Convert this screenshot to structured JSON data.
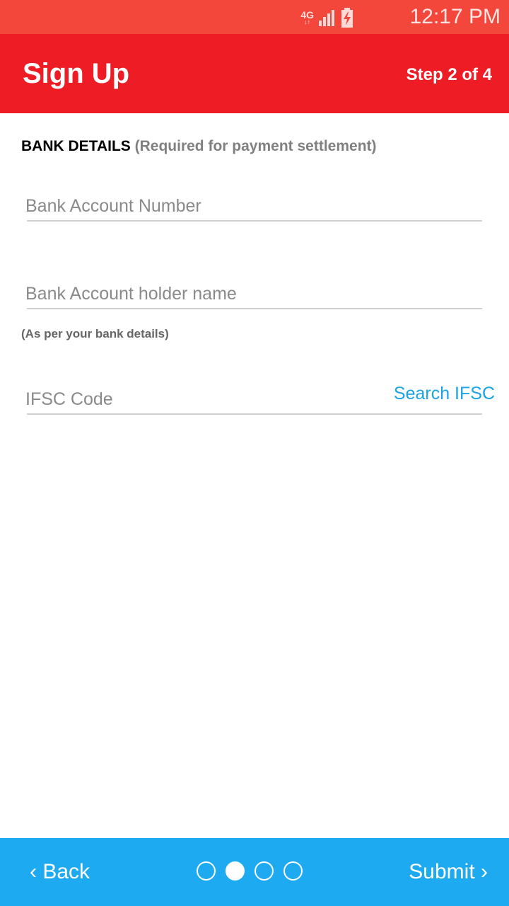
{
  "status_bar": {
    "network_type": "4G",
    "network_arrows": "↓↑",
    "time": "12:17 PM",
    "icons": [
      "network-4g-icon",
      "signal-icon",
      "battery-charging-icon"
    ]
  },
  "app_bar": {
    "title": "Sign Up",
    "step": "Step 2 of 4"
  },
  "form": {
    "section_title": "BANK DETAILS",
    "section_note": "(Required for payment settlement)",
    "account_number": {
      "placeholder": "Bank Account Number",
      "value": ""
    },
    "holder_name": {
      "placeholder": "Bank Account holder name",
      "value": ""
    },
    "holder_hint": "(As per your bank details)",
    "ifsc": {
      "placeholder": "IFSC Code",
      "value": ""
    },
    "search_ifsc_label": "Search IFSC"
  },
  "bottom_bar": {
    "back_label": "‹ Back",
    "submit_label": "Submit ›",
    "steps_total": 4,
    "current_step": 2
  },
  "colors": {
    "status_bar": "#f4473c",
    "app_bar": "#ee1c25",
    "bottom_bar": "#1eaaf1",
    "link": "#1aa3e6"
  }
}
